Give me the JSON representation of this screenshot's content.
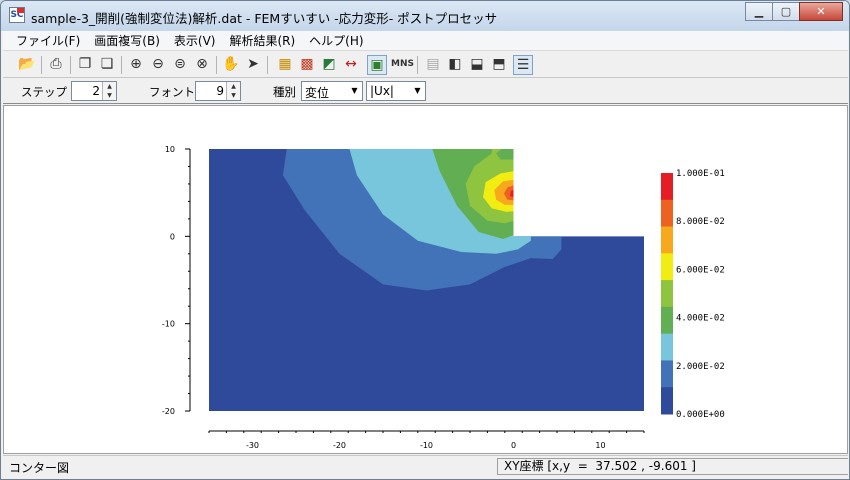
{
  "window": {
    "title": "sample-3_開削(強制変位法)解析.dat - FEMすいすい -応力変形- ポストプロセッサ",
    "app_icon_text": "SC",
    "controls": {
      "minimize": "▁",
      "maximize": "▢",
      "close": "✕"
    }
  },
  "menu": [
    "ファイル(F)",
    "画面複写(B)",
    "表示(V)",
    "解析結果(R)",
    "ヘルプ(H)"
  ],
  "toolbar": {
    "icons": [
      "open-folder-icon",
      "print-icon",
      "copy-icon",
      "paste-icon",
      "zoom-in-icon",
      "zoom-out-icon",
      "zoom-fit-icon",
      "zoom-window-icon",
      "pan-hand-icon",
      "select-arrow-icon",
      "mesh-icon",
      "node-mesh-icon",
      "deform-icon",
      "dimension-icon",
      "contour-icon",
      "mns-icon",
      "table-icon",
      "panel-left-icon",
      "panel-bottom-icon",
      "panel-top-icon",
      "list-icon"
    ]
  },
  "options": {
    "step_label": "ステップ",
    "step_value": "2",
    "font_label": "フォント",
    "font_value": "9",
    "kind_label": "種別",
    "kind_value": "変位",
    "component_value": "|Ux|"
  },
  "colors": {
    "c0": "#304a9b",
    "c1": "#4272b8",
    "c2": "#78c6db",
    "c3": "#62af53",
    "c4": "#8ec43f",
    "c5": "#f1ec11",
    "c6": "#f7a81c",
    "c7": "#ee6221",
    "c8": "#e41e24"
  },
  "chart_data": {
    "type": "heatmap",
    "x_ticks": [
      "-30",
      "-20",
      "-10",
      "0",
      "10"
    ],
    "y_ticks": [
      "10",
      "0",
      "-10",
      "-20"
    ],
    "xlim": [
      -35,
      15
    ],
    "ylim": [
      -20,
      10
    ],
    "legend_labels": [
      "1.000E-01",
      "8.000E-02",
      "6.000E-02",
      "4.000E-02",
      "2.000E-02",
      "0.000E+00"
    ],
    "legend_position": "right"
  },
  "status": {
    "left": "コンター図",
    "right": "XY座標 [x,y  =  37.502 , -9.601 ]"
  }
}
